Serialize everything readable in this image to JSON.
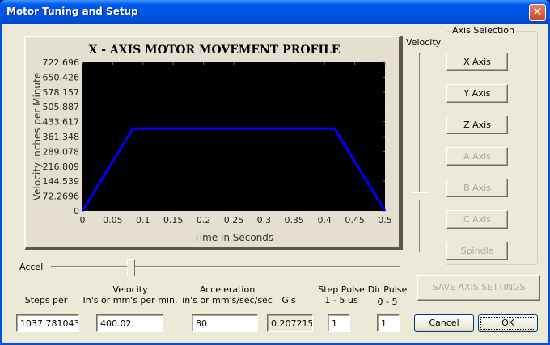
{
  "window": {
    "title": "Motor Tuning and Setup",
    "close_icon": "close-icon"
  },
  "chart_data": {
    "type": "line",
    "title": "X - AXIS MOTOR MOVEMENT PROFILE",
    "xlabel": "Time in Seconds",
    "ylabel": "Velocity inches per Minute",
    "xlim": [
      0,
      0.5
    ],
    "ylim": [
      0,
      722.696
    ],
    "xticks": [
      "0",
      "0.05",
      "0.1",
      "0.15",
      "0.2",
      "0.25",
      "0.3",
      "0.35",
      "0.4",
      "0.45",
      "0.5"
    ],
    "yticks": [
      "0",
      "72.2696",
      "144.539",
      "216.809",
      "289.078",
      "361.348",
      "433.617",
      "505.887",
      "578.157",
      "650.426",
      "722.696"
    ],
    "x": [
      0,
      0.0833,
      0.4167,
      0.5
    ],
    "y": [
      0,
      400,
      400,
      0
    ],
    "line_color": "#0000ff",
    "background": "#000000"
  },
  "velocity_slider": {
    "label": "Velocity",
    "level": 0.29
  },
  "accel_slider": {
    "label": "Accel",
    "level": 0.24
  },
  "axis_selection": {
    "label": "Axis Selection",
    "buttons": [
      {
        "label": "X Axis",
        "enabled": true
      },
      {
        "label": "Y Axis",
        "enabled": true
      },
      {
        "label": "Z Axis",
        "enabled": true
      },
      {
        "label": "A Axis",
        "enabled": false
      },
      {
        "label": "B Axis",
        "enabled": false
      },
      {
        "label": "C Axis",
        "enabled": false
      },
      {
        "label": "Spindle",
        "enabled": false
      }
    ]
  },
  "save_button": "SAVE AXIS SETTINGS",
  "fields": {
    "steps": {
      "label": "Steps per",
      "value": "1037.781043"
    },
    "velocity": {
      "label1": "Velocity",
      "label2": "In's or mm's per min.",
      "value": "400.02"
    },
    "accel": {
      "label1": "Acceleration",
      "label2": "in's or mm's/sec/sec",
      "value": "80"
    },
    "gs": {
      "label": "G's",
      "value": "0.2072152"
    },
    "step_pulse": {
      "label1": "Step Pulse",
      "label2": "1 - 5 us",
      "value": "1"
    },
    "dir_pulse": {
      "label1": "Dir Pulse",
      "label2": "0 - 5",
      "value": "1"
    }
  },
  "cancel": "Cancel",
  "ok": "OK"
}
